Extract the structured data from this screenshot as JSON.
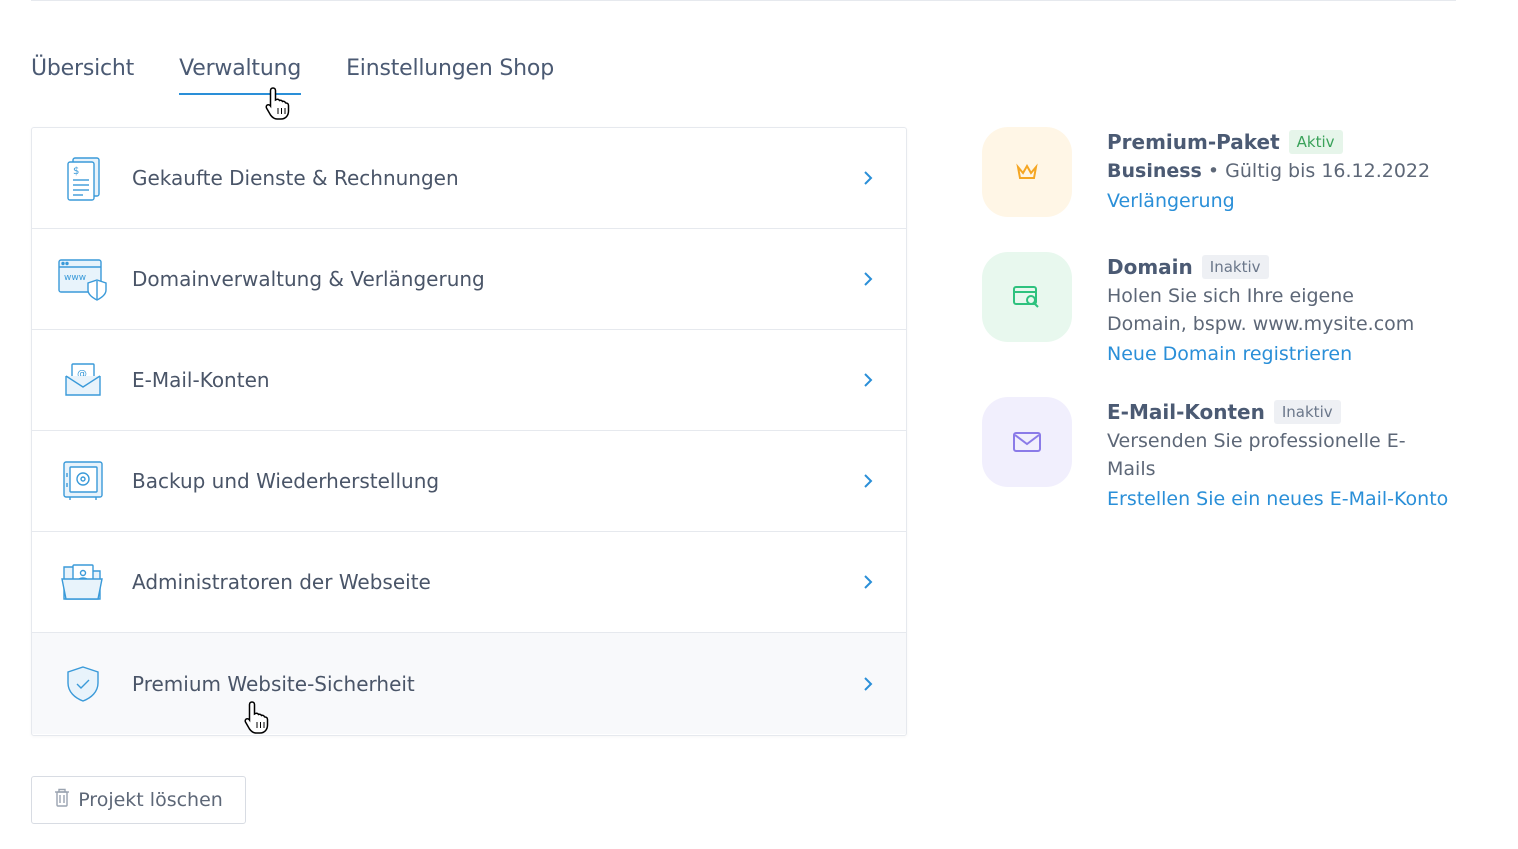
{
  "tabs": [
    {
      "label": "Übersicht"
    },
    {
      "label": "Verwaltung",
      "active": true
    },
    {
      "label": "Einstellungen Shop"
    }
  ],
  "menu": {
    "items": [
      {
        "label": "Gekaufte Dienste & Rechnungen",
        "icon": "invoice-document-icon"
      },
      {
        "label": "Domainverwaltung & Verlängerung",
        "icon": "browser-www-shield-icon"
      },
      {
        "label": "E-Mail-Konten",
        "icon": "email-envelope-icon"
      },
      {
        "label": "Backup und Wiederherstellung",
        "icon": "safe-vault-icon"
      },
      {
        "label": "Administratoren der Webseite",
        "icon": "folder-user-icon"
      },
      {
        "label": "Premium Website-Sicherheit",
        "icon": "shield-check-icon"
      }
    ]
  },
  "services": [
    {
      "title": "Premium-Paket",
      "status": "Aktiv",
      "plan": "Business",
      "desc": "• Gültig bis 16.12.2022",
      "link": "Verlängerung",
      "icon": "crown-icon",
      "badge_color": "#fff6e6",
      "icon_color": "#f5a623"
    },
    {
      "title": "Domain",
      "status": "Inaktiv",
      "desc": "Holen Sie sich Ihre eigene Domain, bspw. www.mysite.com",
      "link": "Neue Domain registrieren",
      "icon": "domain-search-icon",
      "badge_color": "#e8f8ee",
      "icon_color": "#2ec27e"
    },
    {
      "title": "E-Mail-Konten",
      "status": "Inaktiv",
      "desc": "Versenden Sie professionelle E-Mails",
      "link": "Erstellen Sie ein neues E-Mail-Konto",
      "icon": "mail-icon",
      "badge_color": "#f1effd",
      "icon_color": "#8b7be8"
    }
  ],
  "delete_button": {
    "label": "Projekt löschen",
    "icon": "trash-icon"
  },
  "colors": {
    "accent": "#2a8fd8",
    "text": "#4b5a73"
  }
}
